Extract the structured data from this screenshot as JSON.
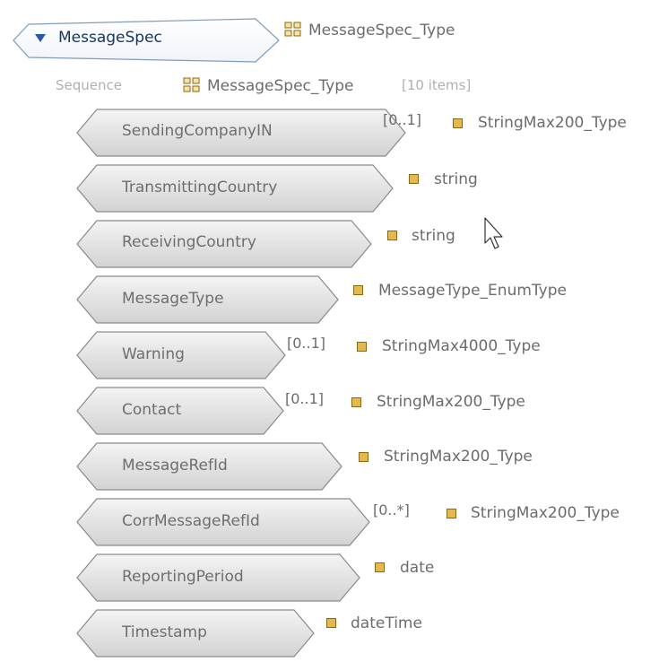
{
  "root": {
    "name": "MessageSpec",
    "type": "MessageSpec_Type",
    "expanded": true
  },
  "sequence": {
    "label": "Sequence",
    "type": "MessageSpec_Type",
    "count": "[10 items]"
  },
  "elements": [
    {
      "name": "SendingCompanyIN",
      "multiplicity": "[0..1]",
      "type": "StringMax200_Type"
    },
    {
      "name": "TransmittingCountry",
      "multiplicity": "",
      "type": "string"
    },
    {
      "name": "ReceivingCountry",
      "multiplicity": "",
      "type": "string"
    },
    {
      "name": "MessageType",
      "multiplicity": "",
      "type": "MessageType_EnumType"
    },
    {
      "name": "Warning",
      "multiplicity": "[0..1]",
      "type": "StringMax4000_Type"
    },
    {
      "name": "Contact",
      "multiplicity": "[0..1]",
      "type": "StringMax200_Type"
    },
    {
      "name": "MessageRefId",
      "multiplicity": "",
      "type": "StringMax200_Type"
    },
    {
      "name": "CorrMessageRefId",
      "multiplicity": "[0..*]",
      "type": "StringMax200_Type"
    },
    {
      "name": "ReportingPeriod",
      "multiplicity": "",
      "type": "date"
    },
    {
      "name": "Timestamp",
      "multiplicity": "",
      "type": "dateTime"
    }
  ],
  "icons": {
    "complex_type": "complex-type-icon",
    "simple_type": "simple-type-icon",
    "expand": "expand-triangle-icon",
    "cursor": "mouse-pointer-icon"
  },
  "colors": {
    "element_fill_top": "#f2f2f2",
    "element_fill_bottom": "#d3d3d3",
    "element_border": "#8a8a8a",
    "root_border": "#7f9db9",
    "root_text": "#17365d",
    "simple_type_icon": "#e4b84a"
  }
}
